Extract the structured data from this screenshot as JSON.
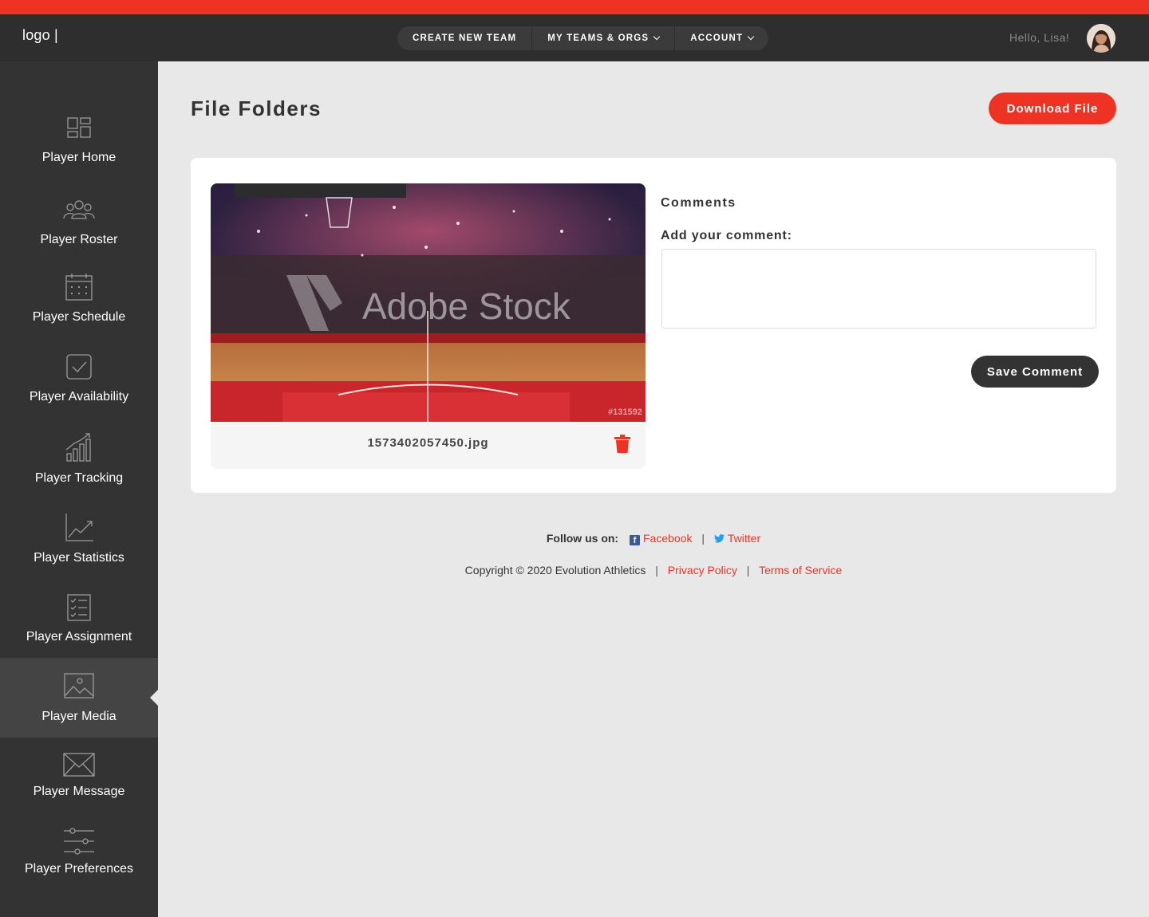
{
  "header": {
    "logo": "logo |",
    "nav": [
      {
        "label": "CREATE NEW TEAM",
        "dropdown": false
      },
      {
        "label": "MY TEAMS & ORGS",
        "dropdown": true
      },
      {
        "label": "ACCOUNT",
        "dropdown": true
      }
    ],
    "greeting": "Hello, Lisa!",
    "avatar_icon": "user-avatar"
  },
  "sidebar": {
    "items": [
      {
        "label": "Player Home",
        "icon": "dashboard-icon"
      },
      {
        "label": "Player Roster",
        "icon": "users-icon"
      },
      {
        "label": "Player Schedule",
        "icon": "calendar-icon"
      },
      {
        "label": "Player Availability",
        "icon": "checkbox-icon"
      },
      {
        "label": "Player Tracking",
        "icon": "bar-chart-icon"
      },
      {
        "label": "Player Statistics",
        "icon": "trend-icon"
      },
      {
        "label": "Player Assignment",
        "icon": "checklist-icon"
      },
      {
        "label": "Player Media",
        "icon": "image-icon",
        "active": true
      },
      {
        "label": "Player Message",
        "icon": "envelope-icon"
      },
      {
        "label": "Player Preferences",
        "icon": "sliders-icon"
      }
    ]
  },
  "main": {
    "title": "File Folders",
    "download_label": "Download File",
    "file": {
      "name": "1573402057450.jpg",
      "watermark": "Adobe Stock",
      "stock_id": "#131592"
    },
    "comments": {
      "title": "Comments",
      "add_label": "Add your comment:",
      "value": "",
      "save_label": "Save Comment"
    }
  },
  "footer": {
    "follow_label": "Follow us on:",
    "facebook": "Facebook",
    "twitter": "Twitter",
    "copyright": "Copyright © 2020 Evolution Athletics",
    "privacy": "Privacy Policy",
    "terms": "Terms of Service"
  },
  "colors": {
    "accent": "#ee3324",
    "sidebar": "#333333",
    "topbar": "#2e2e2e",
    "background": "#e8e8e8"
  }
}
